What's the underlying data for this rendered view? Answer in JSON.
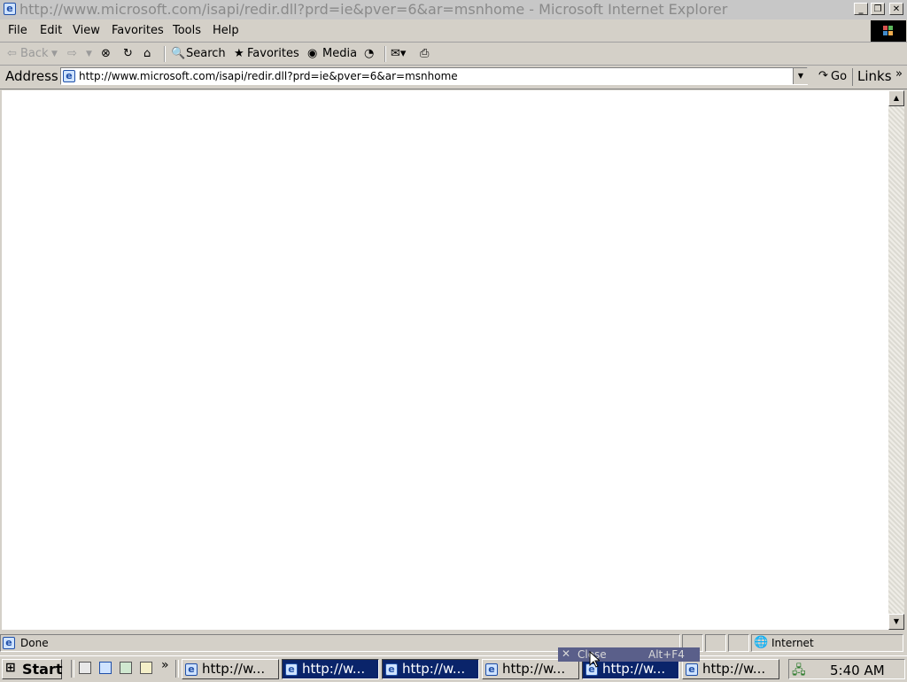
{
  "window": {
    "title": "http://www.microsoft.com/isapi/redir.dll?prd=ie&pver=6&ar=msnhome - Microsoft Internet Explorer"
  },
  "menu": {
    "items": [
      "File",
      "Edit",
      "View",
      "Favorites",
      "Tools",
      "Help"
    ]
  },
  "toolbar": {
    "back": "Back",
    "search": "Search",
    "favorites": "Favorites",
    "media": "Media"
  },
  "address": {
    "label": "Address",
    "url": "http://www.microsoft.com/isapi/redir.dll?prd=ie&pver=6&ar=msnhome",
    "go": "Go",
    "links": "Links"
  },
  "status": {
    "text": "Done",
    "zone": "Internet"
  },
  "taskbar": {
    "start": "Start",
    "tasks": [
      {
        "label": "http://w...",
        "active": false
      },
      {
        "label": "http://w...",
        "active": true
      },
      {
        "label": "http://w...",
        "active": true
      },
      {
        "label": "http://w...",
        "active": false
      },
      {
        "label": "http://w...",
        "active": true
      },
      {
        "label": "http://w...",
        "active": false
      }
    ],
    "clock": "5:40 AM"
  },
  "tooltip": {
    "label": "Close",
    "shortcut": "Alt+F4"
  },
  "colors": {
    "title_inactive": "#c7c7c7",
    "task_active": "#0a246a",
    "chrome": "#d4d0c8"
  }
}
